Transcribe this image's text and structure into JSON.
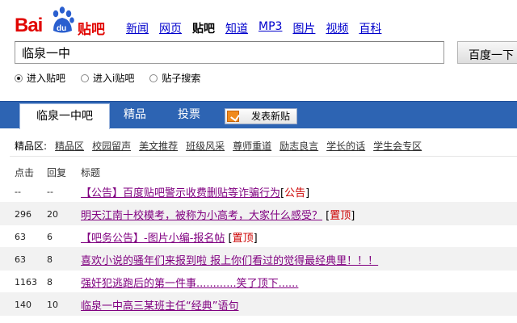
{
  "logo": {
    "text_latin": "Bai",
    "paw_text": "du",
    "text_cn": "贴吧"
  },
  "nav": [
    "新闻",
    "网页",
    "贴吧",
    "知道",
    "MP3",
    "图片",
    "视频",
    "百科"
  ],
  "nav_current": "贴吧",
  "search": {
    "value": "临泉一中",
    "button": "百度一下"
  },
  "radios": [
    {
      "label": "进入贴吧",
      "checked": true
    },
    {
      "label": "进入i贴吧",
      "checked": false
    },
    {
      "label": "贴子搜索",
      "checked": false
    }
  ],
  "tabs": {
    "active": "临泉一中吧",
    "t2": "精品",
    "t3": "投票",
    "post_button": "发表新贴"
  },
  "essence": {
    "label": "精品区:",
    "items": [
      "精品区",
      "校园留声",
      "美文推荐",
      "班级风采",
      "尊师重道",
      "励志良言",
      "学长的话",
      "学生会专区"
    ]
  },
  "table": {
    "headers": {
      "clicks": "点击",
      "replies": "回复",
      "title": "标题"
    },
    "rows": [
      {
        "clicks": "--",
        "replies": "--",
        "title": "【公告】百度贴吧警示收费删贴等诈骗行为",
        "tag": "公告"
      },
      {
        "clicks": "296",
        "replies": "20",
        "title": "明天江南十校模考，被称为小高考，大家什么感受？",
        "tag": "置顶"
      },
      {
        "clicks": "63",
        "replies": "6",
        "title": "【吧务公告】-图片小编-报名帖",
        "tag": "置顶"
      },
      {
        "clicks": "63",
        "replies": "8",
        "title": "喜欢小说的骚年们来报到啦 报上你们看过的觉得最经典里！！！",
        "tag": ""
      },
      {
        "clicks": "1163",
        "replies": "8",
        "title": "强奸犯逃跑后的第一件事............笑了顶下......",
        "tag": ""
      },
      {
        "clicks": "140",
        "replies": "10",
        "title": "临泉一中高三某班主任“经典”语句",
        "tag": ""
      }
    ]
  },
  "colors": {
    "brand_red": "#e10602",
    "tab_blue": "#2d64b3",
    "link_blue": "#0000cc",
    "visited": "#800080",
    "tag_red": "#cc0000"
  }
}
